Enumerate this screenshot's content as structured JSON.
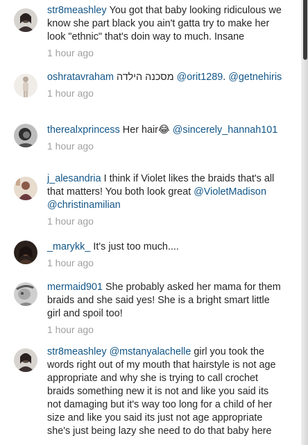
{
  "comments": [
    {
      "username": "str8meashley",
      "segments": [
        {
          "type": "text",
          "text": "You got that baby looking ridiculous we know she part black you ain't gatta try to make her look \"ethnic\" that's doin way to much. Insane"
        }
      ],
      "time": "1 hour ago",
      "avatar_color": "#5a4a42"
    },
    {
      "username": "oshratavraham",
      "segments": [
        {
          "type": "rtl",
          "text": "מסכנה הילדה"
        },
        {
          "type": "text",
          "text": " "
        },
        {
          "type": "mention",
          "text": "@orit1289"
        },
        {
          "type": "text",
          "text": ". "
        },
        {
          "type": "mention",
          "text": "@getnehiris"
        }
      ],
      "time": "1 hour ago",
      "avatar_color": "#c8bdb4"
    },
    {
      "username": "therealxprincess",
      "segments": [
        {
          "type": "text",
          "text": "Her hair😂 "
        },
        {
          "type": "mention",
          "text": "@sincerely_hannah101"
        }
      ],
      "time": "1 hour ago",
      "avatar_color": "#6e6e6e"
    },
    {
      "username": "j_alesandria",
      "segments": [
        {
          "type": "text",
          "text": "I think if Violet likes the braids that's all that matters! You both look great "
        },
        {
          "type": "mention",
          "text": "@VioletMadison"
        },
        {
          "type": "text",
          "text": " "
        },
        {
          "type": "mention",
          "text": "@christinamilian"
        }
      ],
      "time": "1 hour ago",
      "avatar_color": "#6b3a3e"
    },
    {
      "username": "_marykk_",
      "segments": [
        {
          "type": "text",
          "text": "It's just too much...."
        }
      ],
      "time": "1 hour ago",
      "avatar_color": "#3b2a24"
    },
    {
      "username": "mermaid901",
      "segments": [
        {
          "type": "text",
          "text": "She probably asked her mama for them braids and she said yes! She is a bright smart little girl and spoil too!"
        }
      ],
      "time": "1 hour ago",
      "avatar_color": "#8a8a8a"
    },
    {
      "username": "str8meashley",
      "segments": [
        {
          "type": "mention",
          "text": "@mstanyalachelle"
        },
        {
          "type": "text",
          "text": " girl you took the words right out of my mouth that hairstyle is not age appropriate and why she is trying to call crochet braids something new it is not and like you said its not damaging but it's way too long for a child of her size and like you said its just not age appropriate she's just being lazy she need to do that baby here"
        }
      ],
      "time": "",
      "avatar_color": "#5a4a42"
    }
  ],
  "colors": {
    "username": "#125688",
    "text": "#262626",
    "timestamp": "#a0a0a0"
  }
}
